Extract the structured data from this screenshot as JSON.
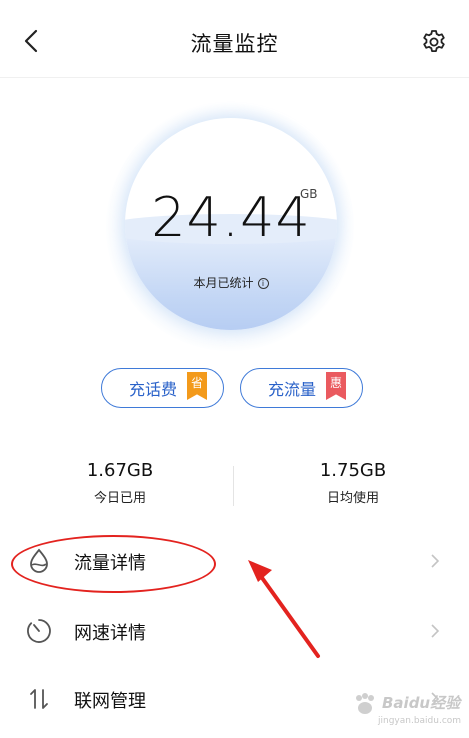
{
  "header": {
    "title": "流量监控",
    "back_icon": "chevron-left-icon",
    "settings_icon": "gear-icon"
  },
  "usage": {
    "value": "24.44",
    "unit": "GB",
    "label": "本月已统计",
    "info_icon": "info-icon",
    "info_glyph": "i"
  },
  "actions": [
    {
      "label": "充话费",
      "tag": "省",
      "tag_color": "#f39a1b"
    },
    {
      "label": "充流量",
      "tag": "惠",
      "tag_color": "#ea5a5f"
    }
  ],
  "stats": [
    {
      "value": "1.67GB",
      "label": "今日已用"
    },
    {
      "value": "1.75GB",
      "label": "日均使用"
    }
  ],
  "menu": [
    {
      "label": "流量详情",
      "icon": "droplet-icon"
    },
    {
      "label": "网速详情",
      "icon": "timer-icon"
    },
    {
      "label": "联网管理",
      "icon": "transfer-arrows-icon"
    }
  ],
  "watermark": {
    "main": "Baidu经验",
    "sub": "jingyan.baidu.com"
  },
  "colors": {
    "accent": "#2a62c9",
    "annotation": "#e3231f"
  }
}
